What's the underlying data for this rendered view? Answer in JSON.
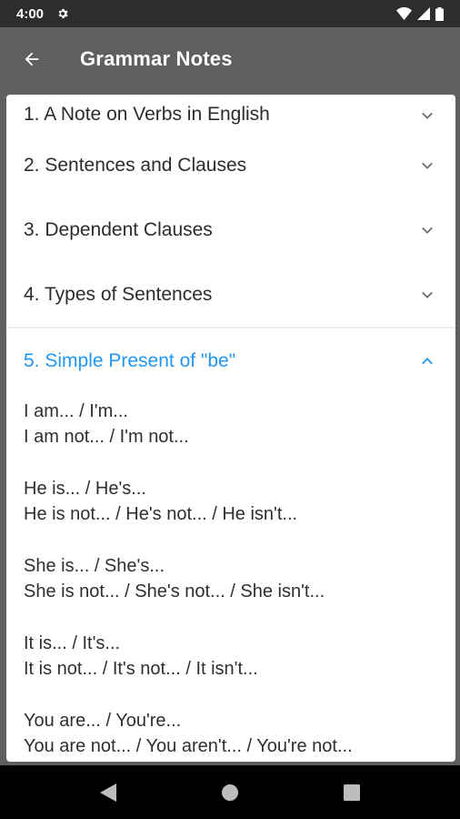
{
  "status_bar": {
    "time": "4:00"
  },
  "app_bar": {
    "title": "Grammar Notes"
  },
  "sections": [
    {
      "label": "1. A Note on Verbs in English",
      "expanded": false
    },
    {
      "label": "2. Sentences and Clauses",
      "expanded": false
    },
    {
      "label": "3. Dependent Clauses",
      "expanded": false
    },
    {
      "label": "4. Types of Sentences",
      "expanded": false
    },
    {
      "label": "5. Simple Present of \"be\"",
      "expanded": true
    }
  ],
  "expanded_content": {
    "groups": [
      [
        "I am... / I'm...",
        "I am not... / I'm not..."
      ],
      [
        "He is... / He's...",
        "He is not... / He's not... / He isn't..."
      ],
      [
        "She is... / She's...",
        "She is not... / She's not... / She isn't..."
      ],
      [
        "It is... / It's...",
        "It is not... / It's not... / It isn't..."
      ],
      [
        "You are... / You're...",
        "You are not... / You aren't... / You're not..."
      ]
    ]
  },
  "colors": {
    "accent": "#2196f3",
    "app_bar": "#5f5f5f",
    "status_bar": "#2d2d2d"
  },
  "icons": {
    "back": "arrow-left-icon",
    "collapsed": "chevron-down-icon",
    "expanded": "chevron-up-icon"
  }
}
